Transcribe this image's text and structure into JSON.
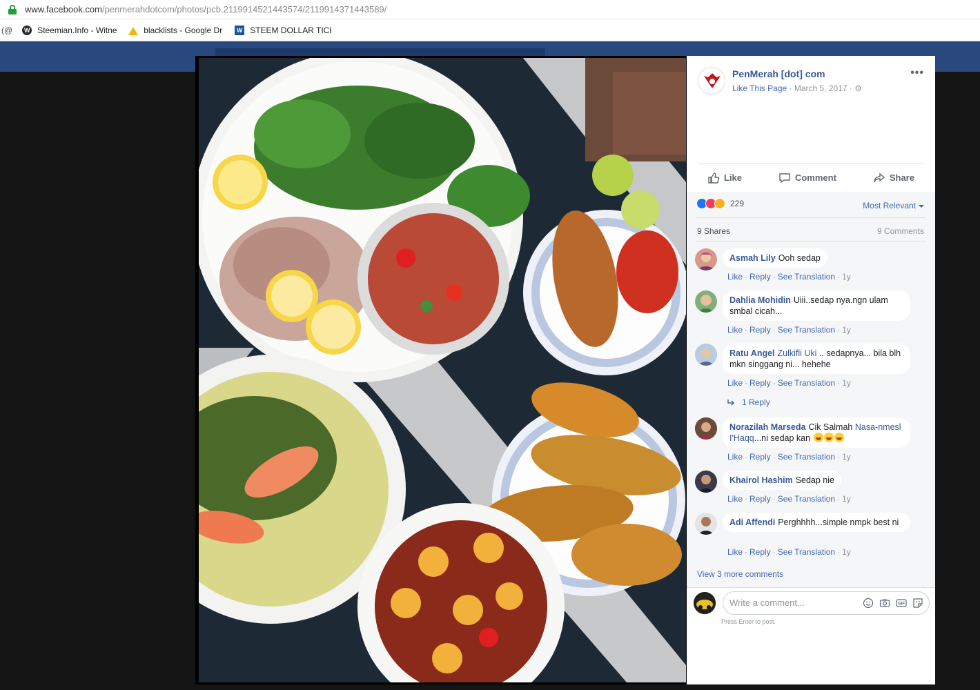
{
  "browser": {
    "url_host": "www.facebook.com",
    "url_path": "/penmerahdotcom/photos/pcb.2119914521443574/2119914371443589/",
    "bookmarks_start": "(@",
    "bookmarks": [
      {
        "label": "Steemian.Info - Witne",
        "icon": "wordpress-icon"
      },
      {
        "label": "blacklists - Google Dr",
        "icon": "google-drive-icon"
      },
      {
        "label": "STEEM DOLLAR TICKE",
        "icon": "steem-icon"
      }
    ]
  },
  "post": {
    "page_name": "PenMerah [dot] com",
    "like_page": "Like This Page",
    "date": "March 5, 2017",
    "privacy_icon": "gear-icon",
    "actions": {
      "like": "Like",
      "comment": "Comment",
      "share": "Share"
    },
    "reactions_count": "229",
    "sort_label": "Most Relevant",
    "shares": "9 Shares",
    "comments_count": "9 Comments"
  },
  "comment_actions": {
    "like": "Like",
    "reply": "Reply",
    "translate": "See Translation",
    "time": "1y"
  },
  "comments": [
    {
      "name": "Asmah Lily",
      "text": "Ooh sedap"
    },
    {
      "name": "Dahlia Mohidin",
      "text": "Uiii..sedap nya.ngn ulam smbal cicah..."
    },
    {
      "name": "Ratu Angel",
      "mention": "Zulkifli Uki",
      "text": ".. sedapnya... bila blh mkn singgang ni... hehehe",
      "replies": "1 Reply"
    },
    {
      "name": "Norazilah Marseda",
      "text_before": "Cik Salmah",
      "mention": "Nasa-nmesl I'Haqq",
      "text": "...ni sedap kan"
    },
    {
      "name": "Khairol Hashim",
      "text": "Sedap nie"
    },
    {
      "name": "Adi Affendi",
      "text": "Perghhhh...simple nmpk best ni"
    }
  ],
  "view_more": "View 3 more comments",
  "composer": {
    "placeholder": "Write a comment...",
    "hint": "Press Enter to post."
  }
}
